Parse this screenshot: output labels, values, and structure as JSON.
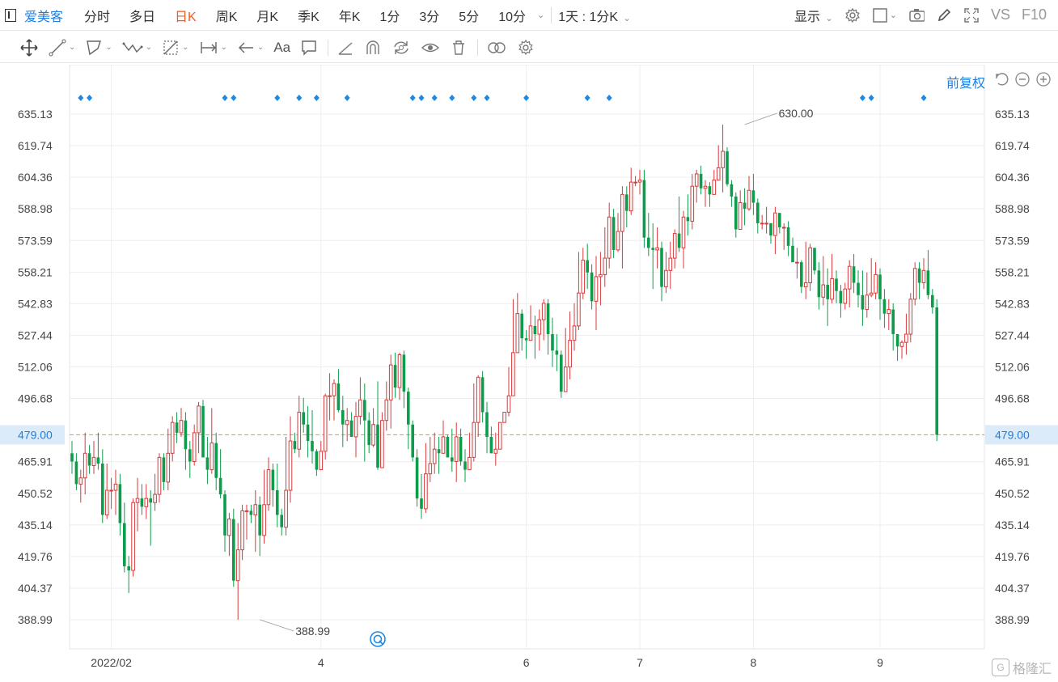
{
  "topbar": {
    "stock_name": "爱美客",
    "tabs": [
      {
        "label": "分时",
        "active": false
      },
      {
        "label": "多日",
        "active": false
      },
      {
        "label": "日K",
        "active": true
      },
      {
        "label": "周K",
        "active": false
      },
      {
        "label": "月K",
        "active": false
      },
      {
        "label": "季K",
        "active": false
      },
      {
        "label": "年K",
        "active": false
      },
      {
        "label": "1分",
        "active": false
      },
      {
        "label": "3分",
        "active": false
      },
      {
        "label": "5分",
        "active": false
      },
      {
        "label": "10分",
        "active": false
      }
    ],
    "period_select": "1天 : 1分K",
    "display_label": "显示",
    "vs_label": "VS",
    "f10_label": "F10",
    "icons": [
      "settings-icon",
      "square-icon",
      "camera-icon",
      "pencil-icon",
      "fullscreen-icon"
    ]
  },
  "drawbar": {
    "tools": [
      "move-icon",
      "line-icon",
      "polygon-icon",
      "wave-icon",
      "fib-icon",
      "range-icon",
      "arrow-icon",
      "text-icon",
      "comment-icon",
      "ruler-icon",
      "magnet-icon",
      "sync-icon",
      "eye-icon",
      "trash-icon",
      "compare-icon",
      "gear-icon"
    ],
    "text_tool_label": "Aa"
  },
  "adjust": {
    "label": "前复权",
    "icons": [
      "undo-icon",
      "zoom-out-icon",
      "zoom-in-icon"
    ]
  },
  "watermark": {
    "text": "格隆汇",
    "logo": "G"
  },
  "colors": {
    "up": "#d9383a",
    "down": "#0d9c4b",
    "accent": "#1e7fe0",
    "current_line": "#e8a24a",
    "marker": "#1e88e5",
    "grid": "#eeeeee"
  },
  "chart_data": {
    "type": "candlestick",
    "title": "",
    "ylim": [
      378,
      646
    ],
    "y_ticks": [
      635.13,
      619.74,
      604.36,
      588.98,
      573.59,
      558.21,
      542.83,
      527.44,
      512.06,
      496.68,
      479.0,
      465.91,
      450.52,
      435.14,
      419.76,
      404.37,
      388.99
    ],
    "current_price": 479.0,
    "x_labels": [
      "2022/02",
      "4",
      "6",
      "7",
      "8",
      "9"
    ],
    "x_label_index": [
      9,
      57,
      104,
      130,
      156,
      185
    ],
    "grid": true,
    "max_label": "630.00",
    "max_value": 630.0,
    "max_index": 154,
    "min_label": "388.99",
    "min_value": 388.99,
    "min_index": 43,
    "event_markers_index": [
      2,
      4,
      35,
      37,
      47,
      52,
      56,
      63,
      78,
      80,
      83,
      87,
      92,
      95,
      104,
      118,
      123,
      181,
      183,
      195
    ],
    "candles": [
      [
        470,
        466,
        476,
        460
      ],
      [
        466,
        455,
        470,
        452
      ],
      [
        455,
        458,
        462,
        446
      ],
      [
        458,
        470,
        480,
        450
      ],
      [
        470,
        464,
        474,
        460
      ],
      [
        464,
        468,
        476,
        460
      ],
      [
        468,
        465,
        480,
        462
      ],
      [
        465,
        440,
        472,
        436
      ],
      [
        440,
        452,
        465,
        438
      ],
      [
        452,
        452,
        458,
        443
      ],
      [
        452,
        455,
        462,
        440
      ],
      [
        455,
        436,
        460,
        430
      ],
      [
        436,
        415,
        446,
        412
      ],
      [
        415,
        413,
        420,
        402
      ],
      [
        413,
        446,
        448,
        410
      ],
      [
        446,
        448,
        458,
        432
      ],
      [
        448,
        444,
        455,
        440
      ],
      [
        444,
        448,
        455,
        438
      ],
      [
        448,
        446,
        452,
        425
      ],
      [
        446,
        450,
        460,
        442
      ],
      [
        450,
        468,
        470,
        446
      ],
      [
        468,
        456,
        470,
        452
      ],
      [
        456,
        470,
        482,
        452
      ],
      [
        470,
        485,
        488,
        466
      ],
      [
        485,
        480,
        490,
        475
      ],
      [
        480,
        486,
        492,
        478
      ],
      [
        486,
        472,
        490,
        462
      ],
      [
        472,
        466,
        476,
        458
      ],
      [
        466,
        480,
        484,
        464
      ],
      [
        480,
        493,
        495,
        470
      ],
      [
        493,
        468,
        496,
        468
      ],
      [
        468,
        462,
        478,
        455
      ],
      [
        462,
        475,
        492,
        460
      ],
      [
        475,
        458,
        480,
        452
      ],
      [
        458,
        450,
        472,
        448
      ],
      [
        450,
        430,
        452,
        422
      ],
      [
        430,
        438,
        441,
        420
      ],
      [
        438,
        408,
        443,
        405
      ],
      [
        408,
        423,
        436,
        389
      ],
      [
        423,
        442,
        445,
        418
      ],
      [
        442,
        442,
        445,
        428
      ],
      [
        442,
        440,
        445,
        436
      ],
      [
        440,
        445,
        452,
        422
      ],
      [
        445,
        430,
        449,
        420
      ],
      [
        430,
        445,
        462,
        426
      ],
      [
        445,
        462,
        468,
        442
      ],
      [
        462,
        452,
        465,
        444
      ],
      [
        452,
        440,
        465,
        434
      ],
      [
        440,
        434,
        443,
        430
      ],
      [
        434,
        452,
        478,
        430
      ],
      [
        452,
        476,
        488,
        446
      ],
      [
        476,
        472,
        480,
        470
      ],
      [
        472,
        490,
        498,
        468
      ],
      [
        490,
        484,
        497,
        480
      ],
      [
        484,
        476,
        493,
        468
      ],
      [
        476,
        471,
        491,
        465
      ],
      [
        471,
        462,
        472,
        459
      ],
      [
        462,
        471,
        476,
        462
      ],
      [
        471,
        498,
        499,
        467
      ],
      [
        498,
        498,
        509,
        486
      ],
      [
        498,
        504,
        506,
        486
      ],
      [
        504,
        491,
        511,
        490
      ],
      [
        491,
        484,
        498,
        473
      ],
      [
        484,
        486,
        492,
        476
      ],
      [
        486,
        478,
        490,
        478
      ],
      [
        478,
        488,
        495,
        468
      ],
      [
        488,
        496,
        507,
        484
      ],
      [
        496,
        486,
        504,
        466
      ],
      [
        486,
        474,
        490,
        470
      ],
      [
        474,
        484,
        492,
        473
      ],
      [
        484,
        463,
        505,
        462
      ],
      [
        463,
        486,
        490,
        466
      ],
      [
        486,
        496,
        505,
        481
      ],
      [
        496,
        513,
        518,
        482
      ],
      [
        513,
        502,
        519,
        497
      ],
      [
        502,
        518,
        519,
        496
      ],
      [
        518,
        500,
        520,
        492
      ],
      [
        500,
        484,
        502,
        472
      ],
      [
        484,
        468,
        486,
        466
      ],
      [
        468,
        448,
        472,
        444
      ],
      [
        448,
        443,
        460,
        438
      ],
      [
        443,
        460,
        475,
        441
      ],
      [
        460,
        465,
        478,
        456
      ],
      [
        465,
        472,
        480,
        460
      ],
      [
        472,
        470,
        478,
        460
      ],
      [
        470,
        478,
        486,
        471
      ],
      [
        478,
        468,
        479,
        468
      ],
      [
        468,
        466,
        482,
        461
      ],
      [
        466,
        478,
        485,
        456
      ],
      [
        478,
        466,
        482,
        464
      ],
      [
        466,
        462,
        472,
        456
      ],
      [
        462,
        468,
        480,
        466
      ],
      [
        468,
        485,
        504,
        466
      ],
      [
        485,
        507,
        508,
        478
      ],
      [
        507,
        490,
        510,
        485
      ],
      [
        490,
        478,
        495,
        470
      ],
      [
        478,
        470,
        483,
        470
      ],
      [
        470,
        472,
        480,
        464
      ],
      [
        472,
        485,
        485,
        474
      ],
      [
        485,
        490,
        490,
        485
      ],
      [
        490,
        498,
        512,
        488
      ],
      [
        498,
        519,
        545,
        498
      ],
      [
        519,
        538,
        548,
        520
      ],
      [
        538,
        526,
        540,
        520
      ],
      [
        526,
        525,
        530,
        516
      ],
      [
        525,
        532,
        542,
        525
      ],
      [
        532,
        528,
        537,
        516
      ],
      [
        528,
        535,
        540,
        520
      ],
      [
        535,
        543,
        545,
        525
      ],
      [
        543,
        528,
        545,
        518
      ],
      [
        528,
        520,
        536,
        512
      ],
      [
        520,
        518,
        528,
        510
      ],
      [
        518,
        500,
        520,
        497
      ],
      [
        500,
        512,
        531,
        510
      ],
      [
        512,
        525,
        539,
        506
      ],
      [
        525,
        532,
        543,
        520
      ],
      [
        532,
        548,
        568,
        530
      ],
      [
        548,
        564,
        570,
        545
      ],
      [
        564,
        558,
        572,
        550
      ],
      [
        558,
        544,
        562,
        540
      ],
      [
        544,
        556,
        566,
        530
      ],
      [
        556,
        557,
        568,
        542
      ],
      [
        557,
        565,
        580,
        551
      ],
      [
        565,
        585,
        592,
        560
      ],
      [
        585,
        569,
        589,
        565
      ],
      [
        569,
        578,
        587,
        568
      ],
      [
        578,
        596,
        600,
        560
      ],
      [
        596,
        588,
        600,
        580
      ],
      [
        588,
        602,
        609,
        586
      ],
      [
        602,
        602,
        605,
        600
      ],
      [
        602,
        603,
        608,
        596
      ],
      [
        603,
        575,
        608,
        570
      ],
      [
        575,
        570,
        587,
        566
      ],
      [
        570,
        569,
        582,
        550
      ],
      [
        569,
        570,
        580,
        560
      ],
      [
        570,
        551,
        573,
        544
      ],
      [
        551,
        559,
        568,
        548
      ],
      [
        559,
        565,
        573,
        550
      ],
      [
        565,
        577,
        579,
        560
      ],
      [
        577,
        570,
        595,
        568
      ],
      [
        570,
        585,
        588,
        560
      ],
      [
        585,
        583,
        596,
        576
      ],
      [
        583,
        600,
        606,
        579
      ],
      [
        600,
        606,
        608,
        592
      ],
      [
        606,
        599,
        610,
        596
      ],
      [
        599,
        600,
        603,
        590
      ],
      [
        600,
        596,
        602,
        590
      ],
      [
        596,
        603,
        608,
        596
      ],
      [
        603,
        609,
        620,
        603
      ],
      [
        609,
        617,
        630,
        597
      ],
      [
        617,
        601,
        619,
        600
      ],
      [
        601,
        595,
        603,
        590
      ],
      [
        595,
        579,
        597,
        575
      ],
      [
        579,
        592,
        598,
        580
      ],
      [
        592,
        589,
        599,
        581
      ],
      [
        589,
        598,
        605,
        588
      ],
      [
        598,
        592,
        606,
        586
      ],
      [
        592,
        582,
        594,
        577
      ],
      [
        582,
        582,
        586,
        579
      ],
      [
        582,
        582,
        590,
        577
      ],
      [
        582,
        576,
        580,
        572
      ],
      [
        576,
        587,
        590,
        567
      ],
      [
        587,
        580,
        587,
        577
      ],
      [
        580,
        580,
        582,
        569
      ],
      [
        580,
        571,
        583,
        566
      ],
      [
        571,
        563,
        575,
        565
      ],
      [
        563,
        563,
        570,
        555
      ],
      [
        563,
        551,
        564,
        548
      ],
      [
        551,
        553,
        573,
        545
      ],
      [
        553,
        570,
        572,
        549
      ],
      [
        570,
        559,
        570,
        557
      ],
      [
        559,
        546,
        563,
        540
      ],
      [
        546,
        552,
        566,
        542
      ],
      [
        552,
        545,
        560,
        532
      ],
      [
        545,
        555,
        567,
        543
      ],
      [
        555,
        549,
        559,
        543
      ],
      [
        549,
        543,
        552,
        536
      ],
      [
        543,
        550,
        553,
        540
      ],
      [
        550,
        561,
        564,
        541
      ],
      [
        561,
        553,
        567,
        548
      ],
      [
        553,
        547,
        559,
        541
      ],
      [
        547,
        540,
        559,
        532
      ],
      [
        540,
        547,
        558,
        536
      ],
      [
        547,
        548,
        565,
        546
      ],
      [
        548,
        557,
        563,
        545
      ],
      [
        557,
        545,
        560,
        535
      ],
      [
        545,
        538,
        550,
        531
      ],
      [
        538,
        540,
        545,
        530
      ],
      [
        540,
        528,
        543,
        520
      ],
      [
        528,
        522,
        528,
        515
      ],
      [
        522,
        524,
        525,
        516
      ],
      [
        524,
        528,
        538,
        518
      ],
      [
        528,
        545,
        548,
        524
      ],
      [
        545,
        560,
        563,
        542
      ],
      [
        560,
        553,
        563,
        545
      ],
      [
        553,
        559,
        565,
        550
      ],
      [
        559,
        547,
        569,
        545
      ],
      [
        547,
        541,
        550,
        538
      ],
      [
        541,
        479,
        545,
        476
      ]
    ]
  }
}
